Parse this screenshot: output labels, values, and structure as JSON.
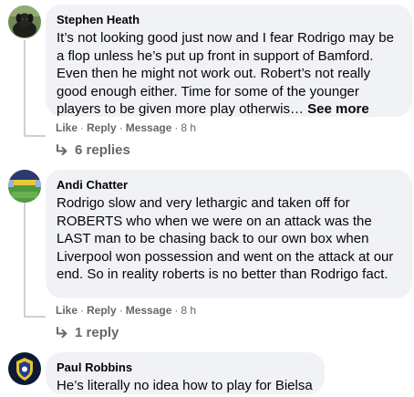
{
  "comments": [
    {
      "author": "Stephen Heath",
      "text": "It’s not looking good just now and I fear Rodrigo may be a flop unless he’s put up front in support of Bamford. Even then he might not work out. Robert’s not really good enough either. Time for some of the younger players to be given more play otherwis…",
      "see_more": "See more",
      "actions": {
        "like": "Like",
        "reply": "Reply",
        "message": "Message",
        "time": "8 h"
      },
      "replies_label": "6 replies",
      "avatar_icon": "dog-avatar-icon"
    },
    {
      "author": "Andi Chatter",
      "text": "Rodrigo slow and very lethargic and taken off for ROBERTS who when we were on an attack was the LAST man to be chasing back to our own box when Liverpool won possession and went on the attack at our end. So in reality roberts is no better than Rodrigo fact.",
      "actions": {
        "like": "Like",
        "reply": "Reply",
        "message": "Message",
        "time": "8 h"
      },
      "replies_label": "1 reply",
      "avatar_icon": "stadium-avatar-icon"
    },
    {
      "author": "Paul Robbins",
      "text": "He’s literally no idea how to play for Bielsa",
      "avatar_icon": "crest-avatar-icon"
    }
  ],
  "separator": "·",
  "colors": {
    "bubble": "#f0f2f5",
    "secondary_text": "#65676b",
    "primary_text": "#050505",
    "thread_line": "#ced0d4"
  },
  "reply_icon": "reply-arrow-icon"
}
